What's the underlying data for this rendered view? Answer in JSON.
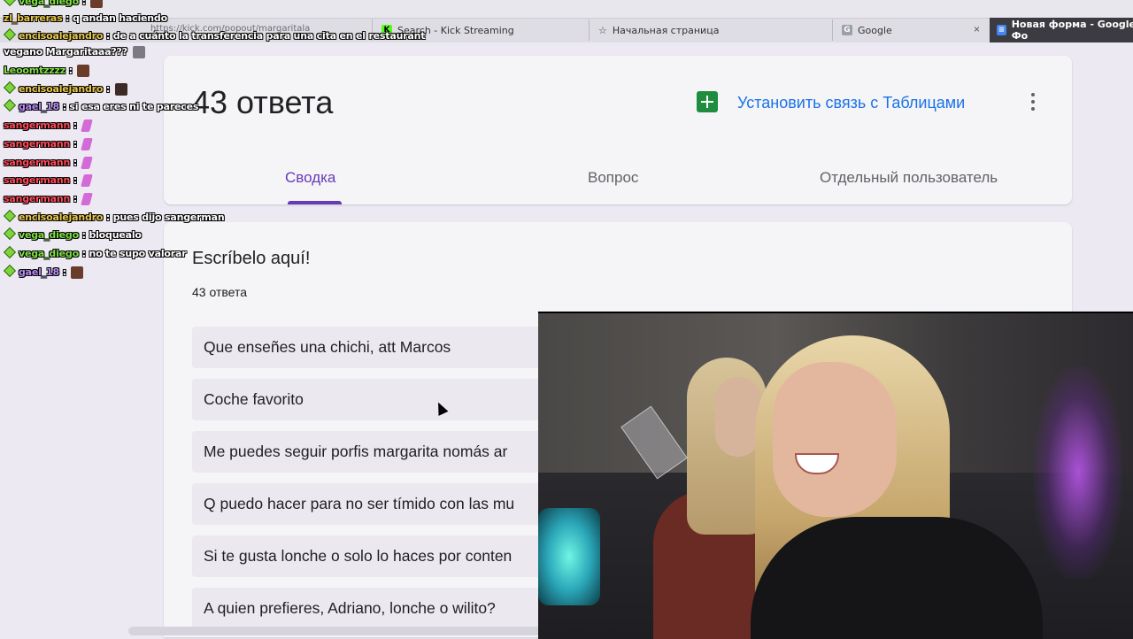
{
  "browser": {
    "url": "https://kick.com/popout/margaritala",
    "tabs": [
      {
        "label": "Search - Kick Streaming",
        "icon": "kick-icon"
      },
      {
        "label": "Начальная страница",
        "icon": "star-icon"
      },
      {
        "label": "Google",
        "icon": "google-icon"
      },
      {
        "label": "Новая форма - Google Фо",
        "icon": "forms-icon"
      }
    ],
    "close_glyph": "×"
  },
  "chat": {
    "messages": [
      {
        "user": "vega_diego",
        "text": ":"
      },
      {
        "user": "zl_barreras",
        "text": ": q andan haciendo"
      },
      {
        "user": "encisoalejandro",
        "text": ": de a cuánto la transferencia para una cita en el restaurant"
      },
      {
        "user": "",
        "text": "vegano Margaritaaa???"
      },
      {
        "user": "Leoomtzzzz",
        "text": ":"
      },
      {
        "user": "encisoalejandro",
        "text": ":"
      },
      {
        "user": "gael_18",
        "text": ": si esa eres ni te pareces"
      },
      {
        "user": "sangermann",
        "text": ":"
      },
      {
        "user": "sangermann",
        "text": ":"
      },
      {
        "user": "sangermann",
        "text": ":"
      },
      {
        "user": "sangermann",
        "text": ":"
      },
      {
        "user": "sangermann",
        "text": ":"
      },
      {
        "user": "encisoalejandro",
        "text": ": pues dijo sangerman"
      },
      {
        "user": "vega_diego",
        "text": ": bloquealo"
      },
      {
        "user": "vega_diego",
        "text": ": no te supo valorar"
      },
      {
        "user": "gael_18",
        "text": ":"
      }
    ]
  },
  "form": {
    "response_count": "43 ответа",
    "link_sheets_label": "Установить связь с Таблицами",
    "tabs": [
      "Сводка",
      "Вопрос",
      "Отдельный пользователь"
    ],
    "active_tab": "Сводка",
    "question": {
      "title": "Escríbelo aquí!",
      "count": "43 ответа",
      "answers": [
        "Que enseñes una chichi, att Marcos",
        "Coche favorito",
        "Me puedes seguir porfis margarita nomás ar",
        "Q puedo hacer para no ser tímido con las mu",
        "Si te gusta lonche o solo lo haces por conten",
        "A quien prefieres, Adriano, lonche o wilito?"
      ]
    }
  },
  "colors": {
    "accent": "#673ab7",
    "link": "#1a73e8",
    "sheets": "#1e8e3e"
  }
}
